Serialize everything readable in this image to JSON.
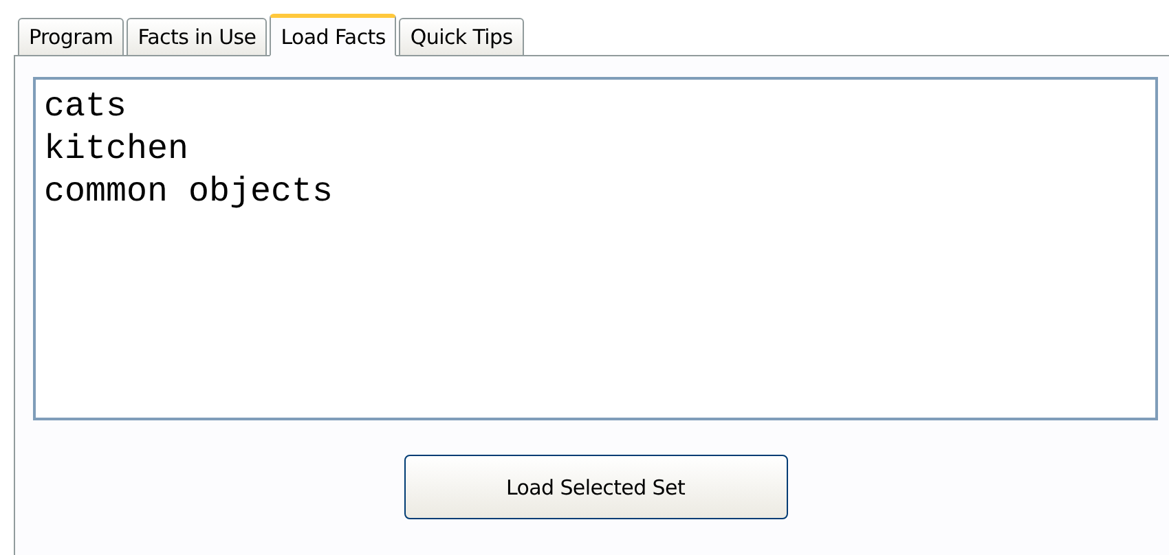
{
  "tabs": [
    {
      "label": "Program",
      "selected": false
    },
    {
      "label": "Facts in Use",
      "selected": false
    },
    {
      "label": "Load Facts",
      "selected": true
    },
    {
      "label": "Quick Tips",
      "selected": false
    }
  ],
  "list": {
    "items": [
      "cats",
      "kitchen",
      "common objects"
    ]
  },
  "button": {
    "label": "Load Selected Set"
  }
}
